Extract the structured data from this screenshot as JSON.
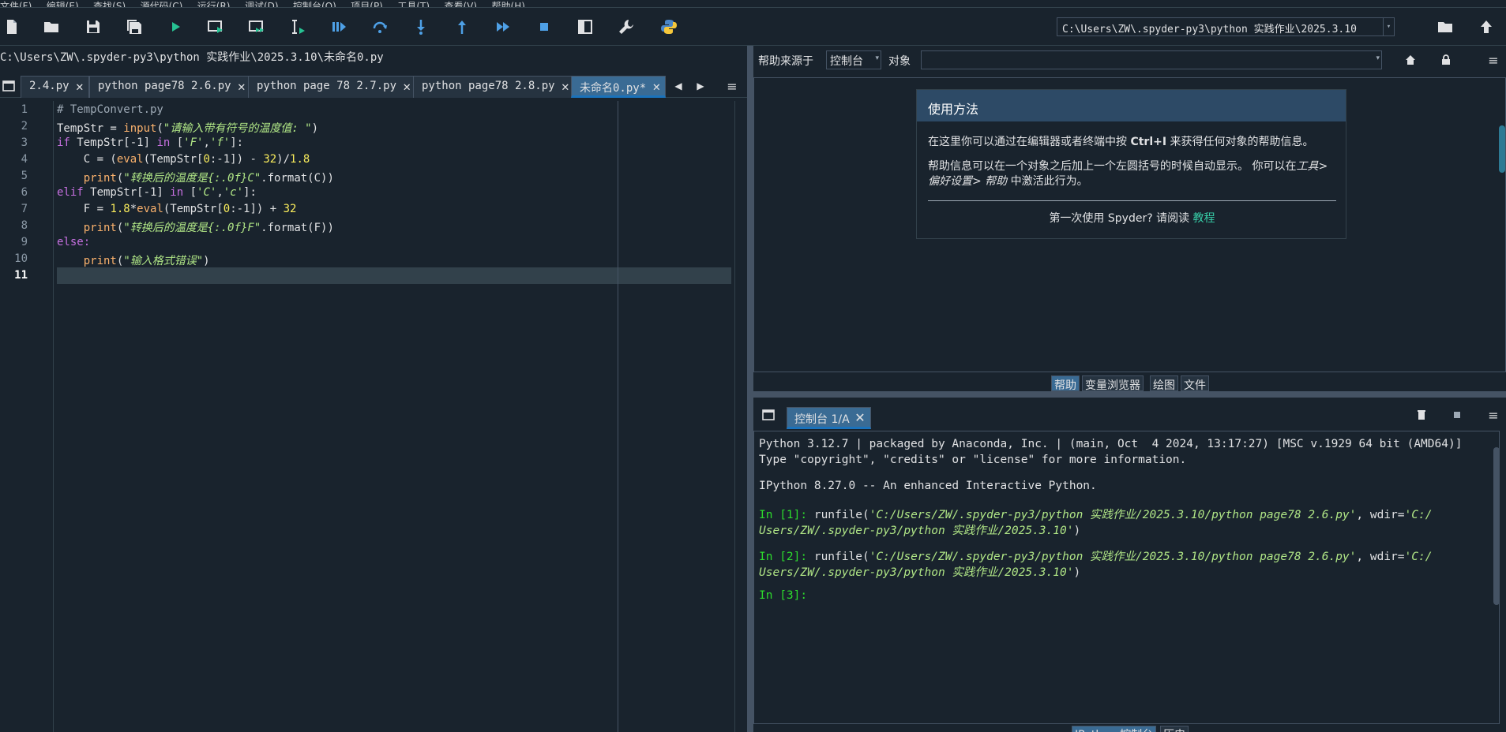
{
  "menu": [
    "文件(F)",
    "编辑(E)",
    "查找(S)",
    "源代码(C)",
    "运行(R)",
    "调试(D)",
    "控制台(O)",
    "项目(P)",
    "工具(T)",
    "查看(V)",
    "帮助(H)"
  ],
  "toolbar": {
    "working_dir": "C:\\Users\\ZW\\.spyder-py3\\python 实践作业\\2025.3.10"
  },
  "editor": {
    "file_path": "C:\\Users\\ZW\\.spyder-py3\\python 实践作业\\2025.3.10\\未命名0.py",
    "tabs": [
      {
        "label": "2.4.py"
      },
      {
        "label": "python page78 2.6.py"
      },
      {
        "label": "python page 78 2.7.py"
      },
      {
        "label": "python page78 2.8.py"
      },
      {
        "label": "未命名0.py*"
      }
    ],
    "line_numbers": [
      "1",
      "2",
      "3",
      "4",
      "5",
      "6",
      "7",
      "8",
      "9",
      "10",
      "11"
    ],
    "code": {
      "l1": "# TempConvert.py",
      "l2a": "TempStr = ",
      "l2b": "input",
      "l2c": "(",
      "l2d": "\"请输入带有符号的温度值: \"",
      "l2e": ")",
      "l3a": "if",
      "l3b": " TempStr[-1] ",
      "l3c": "in",
      "l3d": " [",
      "l3e": "'F'",
      "l3f": ",",
      "l3g": "'f'",
      "l3h": "]:",
      "l4a": "    C = (",
      "l4b": "eval",
      "l4c": "(TempStr[",
      "l4d": "0",
      "l4e": ":-1]) - ",
      "l4f": "32",
      "l4g": ")/",
      "l4h": "1.8",
      "l5a": "    ",
      "l5b": "print",
      "l5c": "(",
      "l5d": "\"转换后的温度是{:.0f}C\"",
      "l5e": ".format(C))",
      "l6a": "elif",
      "l6b": " TempStr[-1] ",
      "l6c": "in",
      "l6d": " [",
      "l6e": "'C'",
      "l6f": ",",
      "l6g": "'c'",
      "l6h": "]:",
      "l7a": "    F = ",
      "l7b": "1.8",
      "l7c": "*",
      "l7d": "eval",
      "l7e": "(TempStr[",
      "l7f": "0",
      "l7g": ":-1]) + ",
      "l7h": "32",
      "l8a": "    ",
      "l8b": "print",
      "l8c": "(",
      "l8d": "\"转换后的温度是{:.0f}F\"",
      "l8e": ".format(F))",
      "l9": "else:",
      "l10a": "    ",
      "l10b": "print",
      "l10c": "(",
      "l10d": "\"输入格式错误\"",
      "l10e": ")"
    }
  },
  "help": {
    "source_label": "帮助来源于",
    "source_value": "控制台",
    "object_label": "对象",
    "card_title": "使用方法",
    "p1_a": "在这里你可以通过在编辑器或者终端中按 ",
    "p1_b": "Ctrl+I",
    "p1_c": " 来获得任何对象的帮助信息。",
    "p2_a": "帮助信息可以在一个对象之后加上一个左圆括号的时候自动显示。 你可以在",
    "p2_b": "工具> 偏好设置> 帮助",
    "p2_c": " 中激活此行为。",
    "first_use": "第一次使用 Spyder? 请阅读 ",
    "tutorial": "教程",
    "tabs": [
      "帮助",
      "变量浏览器",
      "绘图",
      "文件"
    ]
  },
  "console": {
    "tab_label": "控制台 1/A",
    "lines": {
      "c1": "Python 3.12.7 | packaged by Anaconda, Inc. | (main, Oct  4 2024, 13:17:27) [MSC v.1929 64 bit (AMD64)]",
      "c2": "Type \"copyright\", \"credits\" or \"license\" for more information.",
      "c3": "IPython 8.27.0 -- An enhanced Interactive Python.",
      "in1": "In [1]:",
      "in1_a": " runfile(",
      "in1_b": "'C:/Users/ZW/.spyder-py3/python 实践作业/2025.3.10/python page78 2.6.py'",
      "in1_c": ", wdir=",
      "in1_d": "'C:/",
      "in1_e": "Users/ZW/.spyder-py3/python 实践作业/2025.3.10'",
      "in1_f": ")",
      "in2": "In [2]:",
      "in2_a": " runfile(",
      "in2_b": "'C:/Users/ZW/.spyder-py3/python 实践作业/2025.3.10/python page78 2.6.py'",
      "in2_c": ", wdir=",
      "in2_d": "'C:/",
      "in2_e": "Users/ZW/.spyder-py3/python 实践作业/2025.3.10'",
      "in2_f": ")",
      "in3": "In [3]:"
    },
    "bottom_tabs": [
      "IPython 控制台",
      "历史"
    ]
  }
}
